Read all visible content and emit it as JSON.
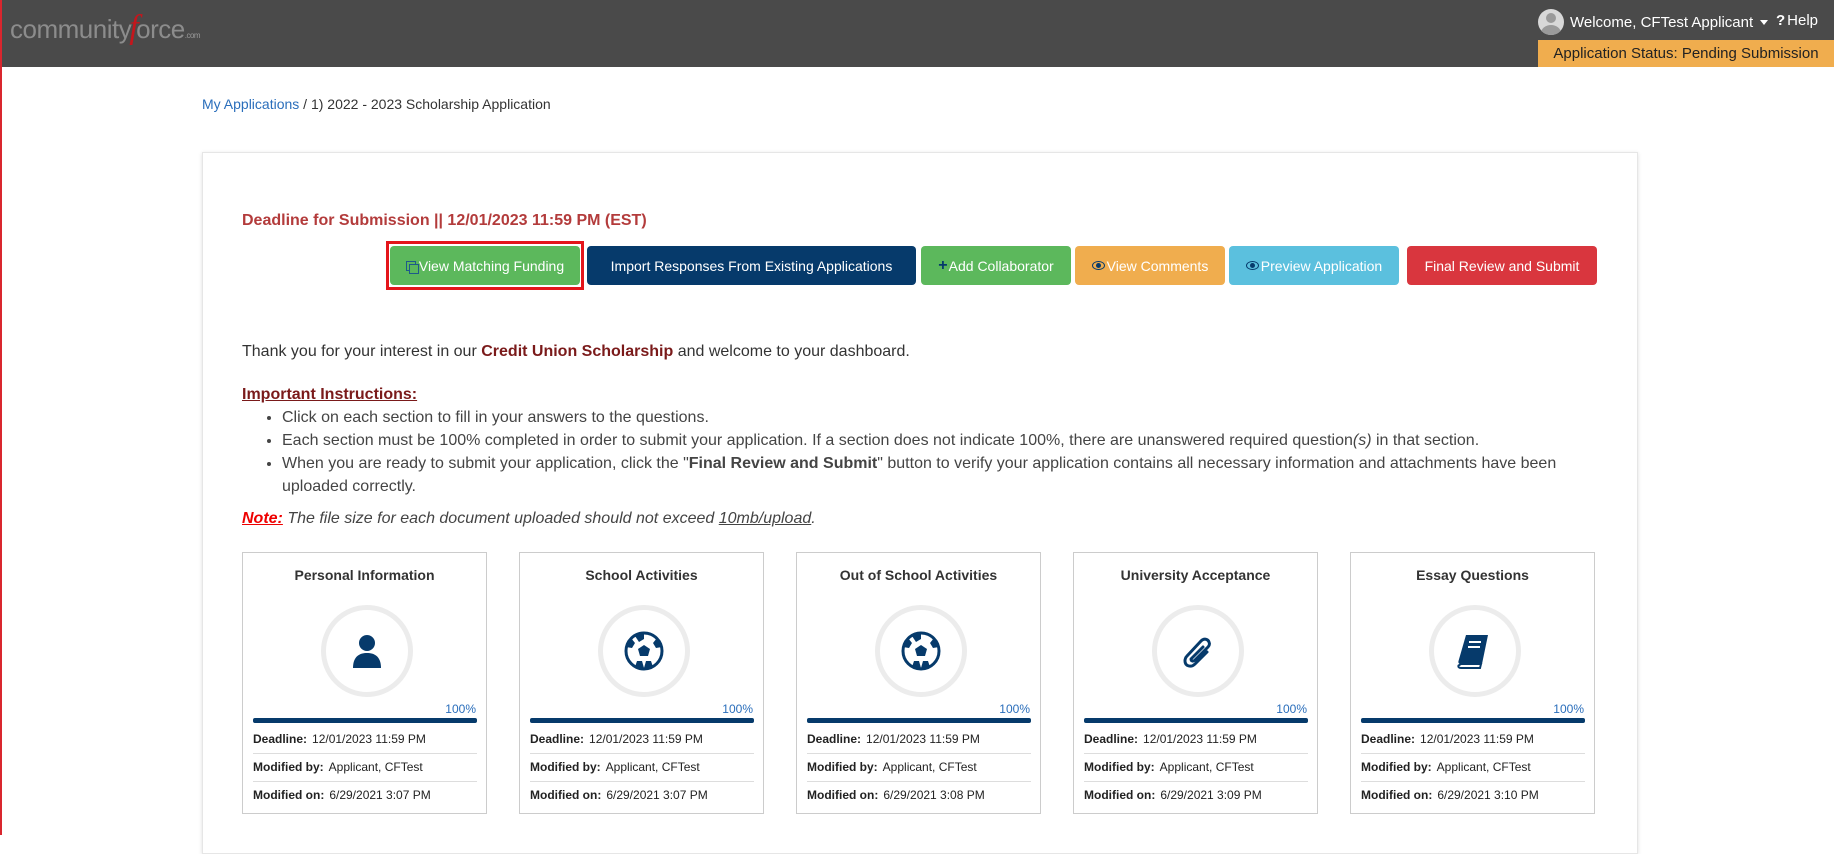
{
  "header": {
    "logo_left": "community",
    "logo_f": "f",
    "logo_right": "orce",
    "logo_suffix": ".com",
    "welcome": "Welcome, CFTest Applicant",
    "help": "Help",
    "status": "Application Status: Pending Submission"
  },
  "breadcrumb": {
    "link": "My Applications",
    "separator": " / ",
    "current": "1) 2022 - 2023 Scholarship Application"
  },
  "deadline": "Deadline for Submission || 12/01/2023 11:59 PM (EST)",
  "buttons": {
    "matching": "View Matching Funding",
    "import": "Import Responses From Existing Applications",
    "collaborator": "Add Collaborator",
    "comments": "View Comments",
    "preview": "Preview Application",
    "final": "Final Review and Submit"
  },
  "intro": {
    "before": "Thank you for your interest in our ",
    "program": "Credit Union Scholarship",
    "after": " and welcome to your dashboard."
  },
  "instructions": {
    "title": "Important Instructions:",
    "item1": "Click on each section to fill in your answers to the questions.",
    "item2a": "Each section must be 100% completed in order to submit your application. If a section does not indicate 100%, there are unanswered required question",
    "item2b": "(s)",
    "item2c": " in that section.",
    "item3a": "When you are ready to submit your application, click the \"",
    "item3b": "Final Review and Submit",
    "item3c": "\" button to verify your application contains all necessary information and attachments have been uploaded correctly."
  },
  "note": {
    "label": "Note:",
    "text": " The file size for each document uploaded should not exceed ",
    "limit": "10mb/upload",
    "end": "."
  },
  "labels": {
    "deadline": "Deadline:",
    "modified_by": "Modified by:",
    "modified_on": "Modified on:"
  },
  "sections": [
    {
      "title": "Personal Information",
      "icon": "user-icon",
      "progress": "100%",
      "deadline": "12/01/2023 11:59 PM",
      "modified_by": "Applicant, CFTest",
      "modified_on": "6/29/2021 3:07 PM"
    },
    {
      "title": "School Activities",
      "icon": "soccer-ball-icon",
      "progress": "100%",
      "deadline": "12/01/2023 11:59 PM",
      "modified_by": "Applicant, CFTest",
      "modified_on": "6/29/2021 3:07 PM"
    },
    {
      "title": "Out of School Activities",
      "icon": "soccer-ball-icon",
      "progress": "100%",
      "deadline": "12/01/2023 11:59 PM",
      "modified_by": "Applicant, CFTest",
      "modified_on": "6/29/2021 3:08 PM"
    },
    {
      "title": "University Acceptance",
      "icon": "paperclip-icon",
      "progress": "100%",
      "deadline": "12/01/2023 11:59 PM",
      "modified_by": "Applicant, CFTest",
      "modified_on": "6/29/2021 3:09 PM"
    },
    {
      "title": "Essay Questions",
      "icon": "book-icon",
      "progress": "100%",
      "deadline": "12/01/2023 11:59 PM",
      "modified_by": "Applicant, CFTest",
      "modified_on": "6/29/2021 3:10 PM"
    }
  ],
  "colors": {
    "topbar": "#4a4a4a",
    "status": "#f0ad4e",
    "navy": "#063a6b",
    "green": "#5cb85c",
    "cyan": "#5bc0de",
    "red": "#d9363e",
    "deadline_text": "#b33b3b",
    "highlight": "#e4151b"
  }
}
